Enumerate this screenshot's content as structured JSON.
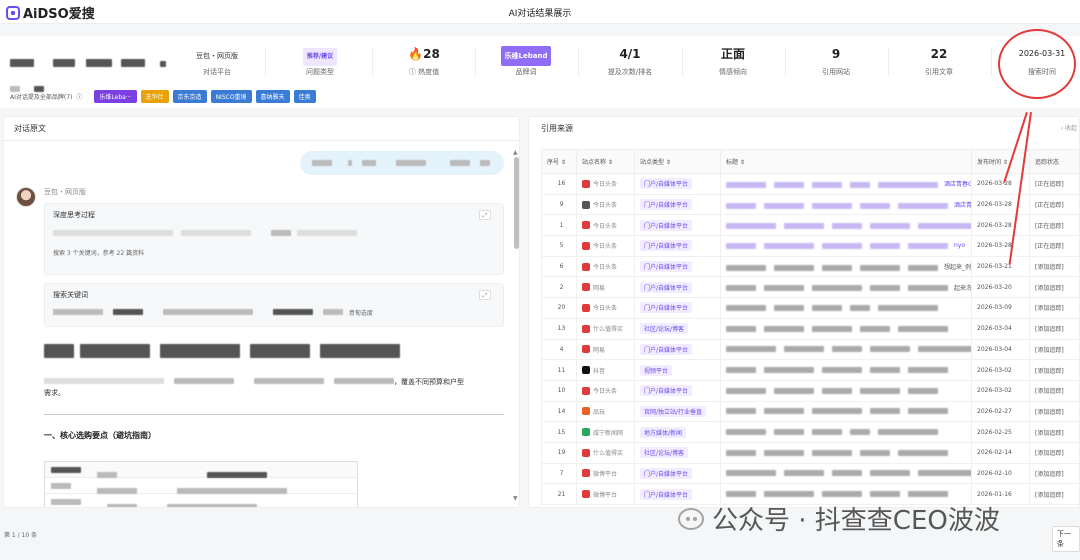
{
  "header": {
    "logo": "AiDSO爱搜",
    "title": "AI对话结果展示"
  },
  "stats": {
    "platform": {
      "value": "豆包・网页版",
      "label": "对话平台"
    },
    "question_type": {
      "value": "推荐/建议",
      "label": "问题类型"
    },
    "heat": {
      "value": "28",
      "label": "热度值"
    },
    "brand_word": {
      "value": "乐维Leband",
      "label": "品牌词"
    },
    "mentions": {
      "value": "4/1",
      "label": "提及次数/排名"
    },
    "sentiment": {
      "value": "正面",
      "label": "情感倾向"
    },
    "cited_sites": {
      "value": "9",
      "label": "引用网站"
    },
    "cited_articles": {
      "value": "22",
      "label": "引用文章"
    },
    "search_time": {
      "value": "2026-03-31",
      "label": "搜索时间"
    }
  },
  "brands": {
    "label": "AI对话提及全部品牌(7)",
    "chips": [
      {
        "label": "乐维Leba···",
        "color": "#7b3fe4"
      },
      {
        "label": "芝华仕",
        "color": "#e8a20c"
      },
      {
        "label": "京东京造",
        "color": "#3a7bd5"
      },
      {
        "label": "NISCO重境",
        "color": "#3a7bd5"
      },
      {
        "label": "喜纳雅天",
        "color": "#3a7bd5"
      },
      {
        "label": "佳奥",
        "color": "#3a7bd5"
      }
    ]
  },
  "left": {
    "title": "对话原文",
    "bot_name": "豆包・网页版",
    "deep_title": "深度思考过程",
    "deep_line2": "搜索 3 个关键词，参考 22 篇资料",
    "kw_title": "搜索关键词",
    "kw_tail": "意甸选度",
    "para_tail": "，覆盖不同预算和户型",
    "para_line2": "需求。",
    "section": "一、核心选购要点（避坑指南）"
  },
  "right": {
    "title": "引用来源",
    "collapse": "‹ 收起",
    "columns": [
      "序号",
      "站点名称",
      "站点类型",
      "标题",
      "发布时间",
      "追踪状态"
    ],
    "rows": [
      {
        "no": "16",
        "site": "今日头条",
        "icon": "#e23a3a",
        "type": "门户/自媒体平台",
        "title_tail": "酒店青春GEO",
        "date": "2026-03-28",
        "status": "[正在追踪]",
        "hi": true
      },
      {
        "no": "9",
        "site": "今日头条",
        "icon": "#555",
        "type": "门户/自媒体平台",
        "title_tail": "酒店青春GEO",
        "date": "2026-03-28",
        "status": "[正在追踪]",
        "hi": true
      },
      {
        "no": "1",
        "site": "今日头条",
        "icon": "#e23a3a",
        "type": "门户/自媒体平台",
        "title_tail": "酒店青春GEO",
        "date": "2026-03-28",
        "status": "[正在追踪]",
        "hi": true
      },
      {
        "no": "5",
        "site": "今日头条",
        "icon": "#e23a3a",
        "type": "门户/自媒体平台",
        "title_tail": "nyo",
        "date": "2026-03-28",
        "status": "[正在追踪]",
        "hi": true
      },
      {
        "no": "6",
        "site": "今日头条",
        "icon": "#e23a3a",
        "type": "门户/自媒体平台",
        "title_tail": "想起来_例下强意味浓的···",
        "date": "2026-03-21",
        "status": "[添加追踪]",
        "hi": false
      },
      {
        "no": "2",
        "site": "网易",
        "icon": "#e23a3a",
        "type": "门户/自媒体平台",
        "title_tail": "起来洗)】",
        "date": "2026-03-20",
        "status": "[添加追踪]",
        "hi": false
      },
      {
        "no": "20",
        "site": "今日头条",
        "icon": "#e23a3a",
        "type": "门户/自媒体平台",
        "title_tail": "",
        "date": "2026-03-09",
        "status": "[添加追踪]",
        "hi": false
      },
      {
        "no": "13",
        "site": "什么值得买",
        "icon": "#e23a3a",
        "type": "社区/论坛/博客",
        "title_tail": "",
        "date": "2026-03-04",
        "status": "[添加追踪]",
        "hi": false
      },
      {
        "no": "4",
        "site": "网易",
        "icon": "#e23a3a",
        "type": "门户/自媒体平台",
        "title_tail": "",
        "date": "2026-03-04",
        "status": "[添加追踪]",
        "hi": false
      },
      {
        "no": "11",
        "site": "抖音",
        "icon": "#111",
        "type": "视频平台",
        "title_tail": "",
        "date": "2026-03-02",
        "status": "[添加追踪]",
        "hi": false
      },
      {
        "no": "10",
        "site": "今日头条",
        "icon": "#e23a3a",
        "type": "门户/自媒体平台",
        "title_tail": "",
        "date": "2026-03-02",
        "status": "[添加追踪]",
        "hi": false
      },
      {
        "no": "14",
        "site": "品玩",
        "icon": "#e8622a",
        "type": "官网/独立站/行业垂直",
        "title_tail": "",
        "date": "2026-02-27",
        "status": "[添加追踪]",
        "hi": false
      },
      {
        "no": "15",
        "site": "咸宁新闻网",
        "icon": "#2aa85a",
        "type": "地方媒体/新闻",
        "title_tail": "",
        "date": "2026-02-25",
        "status": "[添加追踪]",
        "hi": false
      },
      {
        "no": "19",
        "site": "什么值得买",
        "icon": "#e23a3a",
        "type": "社区/论坛/博客",
        "title_tail": "",
        "date": "2026-02-14",
        "status": "[添加追踪]",
        "hi": false
      },
      {
        "no": "7",
        "site": "微博平台",
        "icon": "#e23a3a",
        "type": "门户/自媒体平台",
        "title_tail": "",
        "date": "2026-02-10",
        "status": "[添加追踪]",
        "hi": false
      },
      {
        "no": "21",
        "site": "微博平台",
        "icon": "#e23a3a",
        "type": "门户/自媒体平台",
        "title_tail": "",
        "date": "2026-01-16",
        "status": "[添加追踪]",
        "hi": false
      }
    ]
  },
  "footer": {
    "count": "第 1 / 10 条",
    "next": "下一条"
  },
  "watermark": "公众号 · 抖查查CEO波波"
}
